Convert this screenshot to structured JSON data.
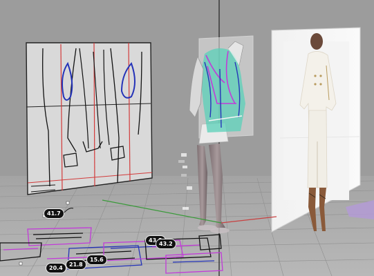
{
  "viewport": {
    "name": "3d-garment-viewport",
    "background": "#9c9c9c",
    "pattern_line_color": "#111111",
    "seam_color": "#d23a3a",
    "armhole_color": "#2433b8",
    "selection_color": "#c23ad9",
    "axis_colors": {
      "x": "#c84040",
      "y": "#3a9a3a",
      "z": "#2a2a2a"
    }
  },
  "measurements": [
    {
      "id": "m1",
      "value": "41.7"
    },
    {
      "id": "m2",
      "value": "43.2"
    },
    {
      "id": "m3",
      "value": "43.2"
    },
    {
      "id": "m4",
      "value": "15.6"
    },
    {
      "id": "m5",
      "value": "21.8"
    },
    {
      "id": "m6",
      "value": "20.4"
    }
  ],
  "reference_image": {
    "description_hidden": true,
    "garment_color": "#f4f1ea"
  },
  "avatar": {
    "garment_tint": "#5ad0b8"
  }
}
